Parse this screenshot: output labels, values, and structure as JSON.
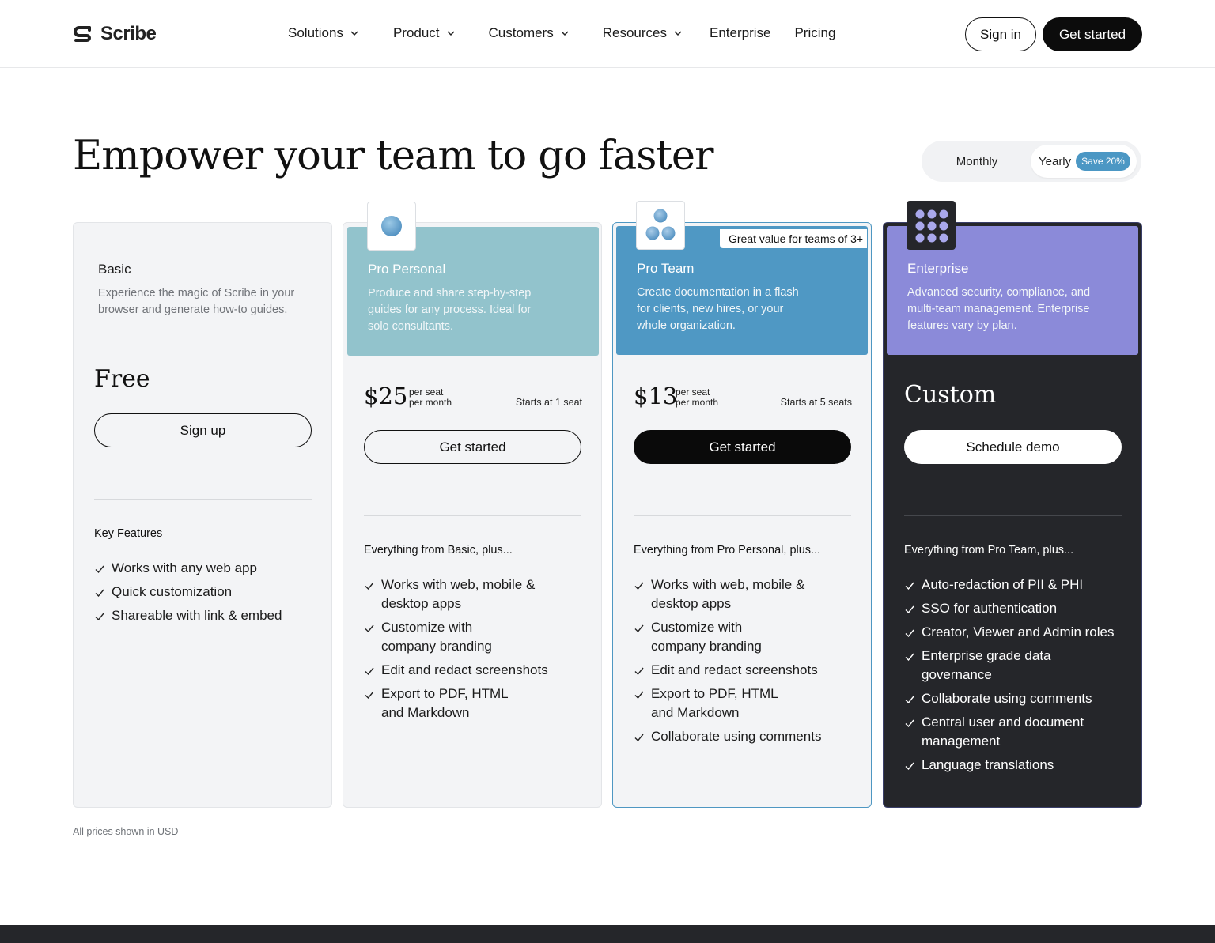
{
  "brand": {
    "name": "Scribe"
  },
  "nav": {
    "items": [
      {
        "label": "Solutions",
        "has_menu": true
      },
      {
        "label": "Product",
        "has_menu": true
      },
      {
        "label": "Customers",
        "has_menu": true
      },
      {
        "label": "Resources",
        "has_menu": true
      },
      {
        "label": "Enterprise",
        "has_menu": false
      },
      {
        "label": "Pricing",
        "has_menu": false
      }
    ],
    "sign_in": "Sign in",
    "get_started": "Get started"
  },
  "hero": {
    "title": "Empower your team to go faster"
  },
  "billing_toggle": {
    "monthly": "Monthly",
    "yearly": "Yearly",
    "save_badge": "Save 20%",
    "selected": "Yearly"
  },
  "plans": {
    "basic": {
      "name": "Basic",
      "description": "Experience the magic of Scribe in your browser and generate how-to guides.",
      "price": "Free",
      "cta": "Sign up",
      "features_title": "Key Features",
      "features": [
        "Works with any web app",
        "Quick customization",
        "Shareable with link & embed"
      ]
    },
    "personal": {
      "name": "Pro Personal",
      "description": "Produce and share step-by-step guides for any process. Ideal for solo consultants.",
      "price": "$25",
      "price_unit_1": "per seat",
      "price_unit_2": "per month",
      "starts": "Starts at 1 seat",
      "cta": "Get started",
      "features_title": "Everything from Basic, plus...",
      "features": [
        "Works with web, mobile & desktop apps",
        "Customize with company branding",
        "Edit and redact screenshots",
        "Export to PDF, HTML and Markdown"
      ],
      "color": "#92c3cc"
    },
    "team": {
      "name": "Pro Team",
      "ribbon": "Great value for teams of 3+",
      "description": "Create documentation in a flash for clients, new hires, or your whole organization.",
      "price": "$13",
      "price_unit_1": "per seat",
      "price_unit_2": "per month",
      "starts": "Starts at 5 seats",
      "cta": "Get started",
      "features_title": "Everything from Pro Personal, plus...",
      "features": [
        "Works with web, mobile & desktop apps",
        "Customize with company branding",
        "Edit and redact screenshots",
        "Export to PDF, HTML and Markdown",
        "Collaborate using comments"
      ],
      "color": "#4f98c4"
    },
    "enterprise": {
      "name": "Enterprise",
      "description": "Advanced security, compliance, and multi-team management. Enterprise features vary by plan.",
      "price": "Custom",
      "cta": "Schedule demo",
      "features_title": "Everything from Pro Team, plus...",
      "features": [
        "Auto-redaction of PII & PHI",
        "SSO for authentication",
        "Creator, Viewer and Admin roles",
        "Enterprise grade data governance",
        "Collaborate using comments",
        "Central user and document management",
        "Language translations"
      ],
      "color": "#8b8ad9"
    }
  },
  "footnote": "All prices shown in USD"
}
